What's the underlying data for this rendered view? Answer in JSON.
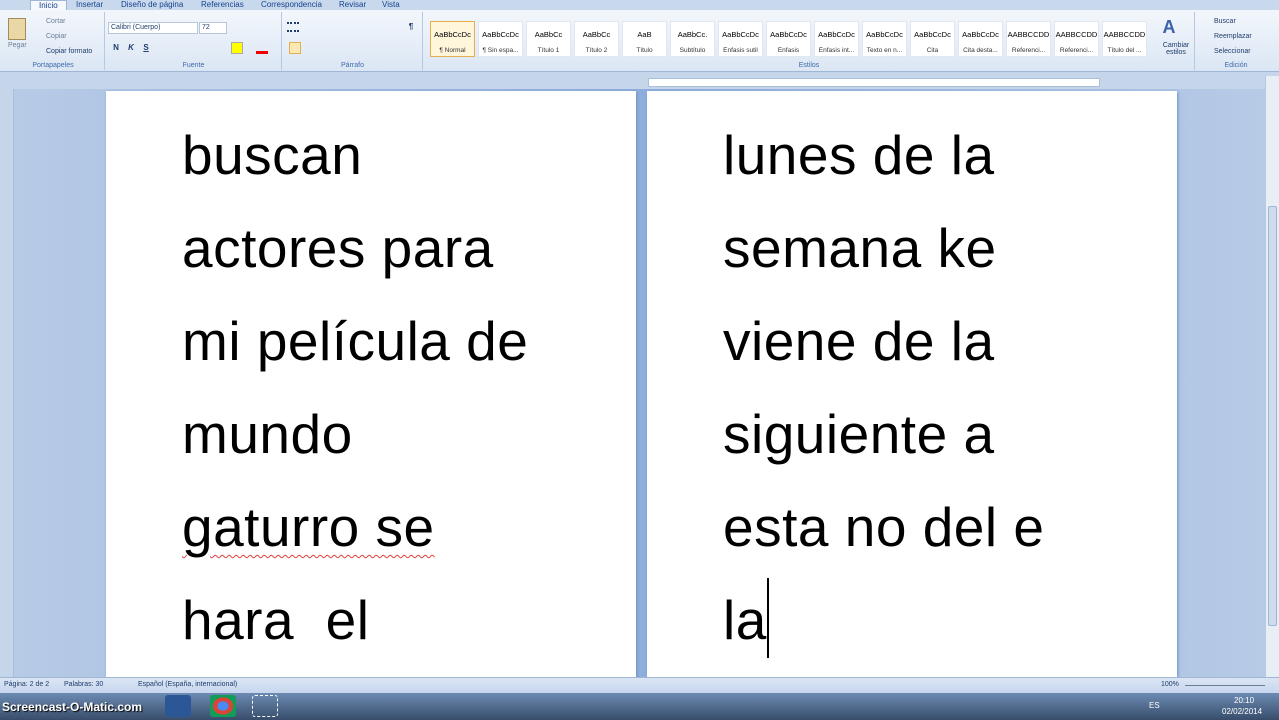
{
  "tabs": [
    "Inicio",
    "Insertar",
    "Diseño de página",
    "Referencias",
    "Correspondencia",
    "Revisar",
    "Vista"
  ],
  "clipboard": {
    "paste": "Pegar",
    "cut": "Cortar",
    "copy": "Copiar",
    "format_painter": "Copiar formato",
    "label": "Portapapeles"
  },
  "font": {
    "name": "Calibri (Cuerpo)",
    "size": "72",
    "label": "Fuente",
    "bold": "N",
    "italic": "K",
    "underline": "S"
  },
  "paragraph": {
    "label": "Párrafo",
    "pilcrow": "¶"
  },
  "styles": {
    "label": "Estilos",
    "items": [
      {
        "preview": "AaBbCcDc",
        "name": "¶ Normal"
      },
      {
        "preview": "AaBbCcDc",
        "name": "¶ Sin espa..."
      },
      {
        "preview": "AaBbCc",
        "name": "Título 1"
      },
      {
        "preview": "AaBbCc",
        "name": "Título 2"
      },
      {
        "preview": "AaB",
        "name": "Título"
      },
      {
        "preview": "AaBbCc.",
        "name": "Subtítulo"
      },
      {
        "preview": "AaBbCcDc",
        "name": "Énfasis sutil"
      },
      {
        "preview": "AaBbCcDc",
        "name": "Énfasis"
      },
      {
        "preview": "AaBbCcDc",
        "name": "Énfasis int..."
      },
      {
        "preview": "AaBbCcDc",
        "name": "Texto en n..."
      },
      {
        "preview": "AaBbCcDc",
        "name": "Cita"
      },
      {
        "preview": "AaBbCcDc",
        "name": "Cita desta..."
      },
      {
        "preview": "AABBCCDD",
        "name": "Referenci..."
      },
      {
        "preview": "AABBCCDD",
        "name": "Referenci..."
      },
      {
        "preview": "AABBCCDD",
        "name": "Título del ..."
      }
    ],
    "change": "Cambiar estilos"
  },
  "editing": {
    "find": "Buscar",
    "replace": "Reemplazar",
    "select": "Seleccionar",
    "label": "Edición"
  },
  "page1": {
    "lines": [
      "buscan",
      "actores para",
      "mi película de",
      "mundo",
      "gaturro se",
      "hara  el"
    ]
  },
  "page2": {
    "lines": [
      "lunes de la",
      "semana ke",
      "viene de la",
      "siguiente a",
      "esta no del e",
      "la"
    ]
  },
  "status": {
    "page": "Página: 2 de 2",
    "words": "Palabras: 30",
    "language": "Español (España, internacional)",
    "zoom": "100%"
  },
  "taskbar": {
    "watermark": "Screencast-O-Matic.com",
    "lang": "ES",
    "time": "20:10",
    "date": "02/02/2014"
  }
}
